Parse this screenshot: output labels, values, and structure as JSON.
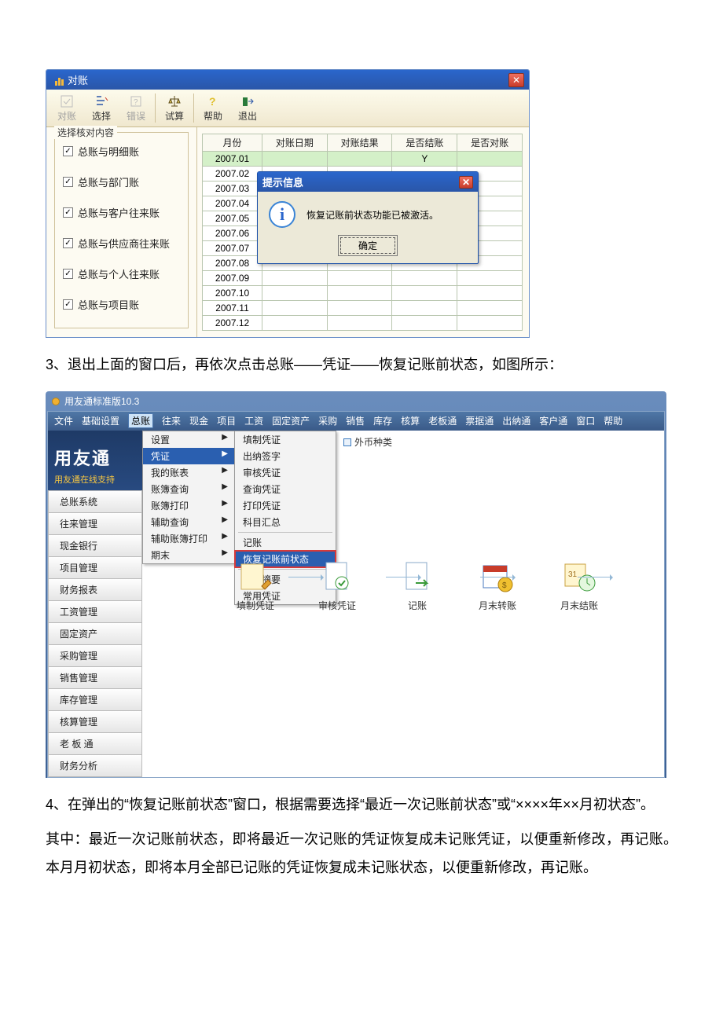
{
  "fig1": {
    "window_title": "对账",
    "toolbar": [
      {
        "label": "对账",
        "disabled": true
      },
      {
        "label": "选择",
        "disabled": false
      },
      {
        "label": "错误",
        "disabled": true
      },
      {
        "label": "试算",
        "disabled": false
      },
      {
        "label": "帮助",
        "disabled": false
      },
      {
        "label": "退出",
        "disabled": false
      }
    ],
    "group_title": "选择核对内容",
    "checks": [
      "总账与明细账",
      "总账与部门账",
      "总账与客户往来账",
      "总账与供应商往来账",
      "总账与个人往来账",
      "总账与项目账"
    ],
    "cols": [
      "月份",
      "对账日期",
      "对账结果",
      "是否结账",
      "是否对账"
    ],
    "rows": [
      {
        "month": "2007.01",
        "sel": true,
        "settled": "Y"
      },
      {
        "month": "2007.02"
      },
      {
        "month": "2007.03"
      },
      {
        "month": "2007.04"
      },
      {
        "month": "2007.05"
      },
      {
        "month": "2007.06"
      },
      {
        "month": "2007.07"
      },
      {
        "month": "2007.08"
      },
      {
        "month": "2007.09"
      },
      {
        "month": "2007.10"
      },
      {
        "month": "2007.11"
      },
      {
        "month": "2007.12"
      }
    ],
    "msgbox": {
      "title": "提示信息",
      "text": "恢复记账前状态功能已被激活。",
      "ok": "确定"
    }
  },
  "instr_step3": "3、退出上面的窗口后，再依次点击总账——凭证——恢复记账前状态，如图所示：",
  "fig2": {
    "app_title": "用友通标准版10.3",
    "menu": [
      "文件",
      "基础设置",
      "总账",
      "往来",
      "现金",
      "项目",
      "工资",
      "固定资产",
      "采购",
      "销售",
      "库存",
      "核算",
      "老板通",
      "票据通",
      "出纳通",
      "客户通",
      "窗口",
      "帮助"
    ],
    "brand": "用友通",
    "brand_sub": "用友通在线支持",
    "modules": [
      "总账系统",
      "往来管理",
      "现金银行",
      "项目管理",
      "财务报表",
      "工资管理",
      "固定资产",
      "采购管理",
      "销售管理",
      "库存管理",
      "核算管理",
      "老 板 通",
      "财务分析"
    ],
    "topbar": [
      "常用摘要",
      "外币种类"
    ],
    "dropdown1": [
      {
        "label": "设置",
        "arrow": true
      },
      {
        "label": "凭证",
        "arrow": true,
        "hl": true
      },
      {
        "label": "我的账表",
        "arrow": true
      },
      {
        "label": "账簿查询",
        "arrow": true
      },
      {
        "label": "账簿打印",
        "arrow": true
      },
      {
        "label": "辅助查询",
        "arrow": true
      },
      {
        "label": "辅助账簿打印",
        "arrow": true
      },
      {
        "label": "期末",
        "arrow": true
      }
    ],
    "dropdown2": [
      {
        "label": "填制凭证"
      },
      {
        "label": "出纳签字"
      },
      {
        "label": "审核凭证"
      },
      {
        "label": "查询凭证"
      },
      {
        "label": "打印凭证"
      },
      {
        "label": "科目汇总"
      },
      {
        "sep": true
      },
      {
        "label": "记账"
      },
      {
        "label": "恢复记账前状态",
        "hl": true
      },
      {
        "sep": true
      },
      {
        "label": "常用摘要"
      },
      {
        "label": "常用凭证"
      }
    ],
    "flow": [
      "填制凭证",
      "审核凭证",
      "记账",
      "月末转账",
      "月末结账"
    ]
  },
  "instr_step4": "4、在弹出的“恢复记账前状态”窗口，根据需要选择“最近一次记账前状态”或“××××年××月初状态”。",
  "instr_desc1": "其中：最近一次记账前状态，即将最近一次记账的凭证恢复成未记账凭证，以便重新修改，再记账。本月月初状态，即将本月全部已记账的凭证恢复成未记账状态，以便重新修改，再记账。"
}
